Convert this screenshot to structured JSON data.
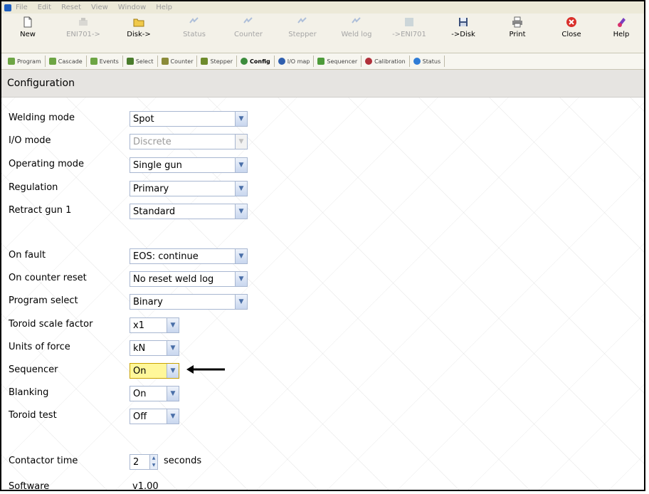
{
  "menu": [
    "File",
    "Edit",
    "Reset",
    "View",
    "Window",
    "Help"
  ],
  "toolbar": {
    "buttons": [
      {
        "label": "New",
        "icon": "new-document-icon",
        "enabled": true
      },
      {
        "label": "ENI701->",
        "icon": "device-read-icon",
        "enabled": false
      },
      {
        "label": "Disk->",
        "icon": "open-folder-icon",
        "enabled": true
      },
      {
        "label": "Status",
        "icon": "status-icon",
        "enabled": false
      },
      {
        "label": "Counter",
        "icon": "counter-icon",
        "enabled": false
      },
      {
        "label": "Stepper",
        "icon": "stepper-icon",
        "enabled": false
      },
      {
        "label": "Weld log",
        "icon": "weld-log-icon",
        "enabled": false
      },
      {
        "label": "->ENI701",
        "icon": "device-write-icon",
        "enabled": false
      },
      {
        "label": "->Disk",
        "icon": "save-disk-icon",
        "enabled": true
      },
      {
        "label": "Print",
        "icon": "printer-icon",
        "enabled": true
      },
      {
        "label": "Close",
        "icon": "close-icon",
        "enabled": true
      },
      {
        "label": "Help",
        "icon": "help-icon",
        "enabled": true
      }
    ]
  },
  "tabs": [
    "Program",
    "Cascade",
    "Events",
    "Select",
    "Counter",
    "Stepper",
    "Config",
    "I/O map",
    "Sequencer",
    "Calibration",
    "Status"
  ],
  "section_title": "Configuration",
  "fields": [
    {
      "label": "Welding mode",
      "value": "Spot",
      "disabled": false
    },
    {
      "label": "I/O mode",
      "value": "Discrete",
      "disabled": true
    },
    {
      "label": "Operating mode",
      "value": "Single gun",
      "disabled": false
    },
    {
      "label": "Regulation",
      "value": "Primary",
      "disabled": false
    },
    {
      "label": "Retract gun 1",
      "value": "Standard",
      "disabled": false
    },
    {
      "label": "On fault",
      "value": "EOS: continue",
      "disabled": false
    },
    {
      "label": "On counter reset",
      "value": "No reset weld log",
      "disabled": false
    },
    {
      "label": "Program select",
      "value": "Binary",
      "disabled": false
    },
    {
      "label": "Toroid scale factor",
      "value": "x1",
      "disabled": false
    },
    {
      "label": "Units of force",
      "value": "kN",
      "disabled": false
    },
    {
      "label": "Sequencer",
      "value": "On",
      "disabled": false
    },
    {
      "label": "Blanking",
      "value": "On",
      "disabled": false
    },
    {
      "label": "Toroid test",
      "value": "Off",
      "disabled": false
    }
  ],
  "contactor": {
    "label": "Contactor time",
    "value": "2",
    "unit": "seconds"
  },
  "software": {
    "label": "Software",
    "value": "v1.00"
  },
  "colors": {
    "highlight": "#fff79a",
    "accent": "#1f5fbf"
  }
}
